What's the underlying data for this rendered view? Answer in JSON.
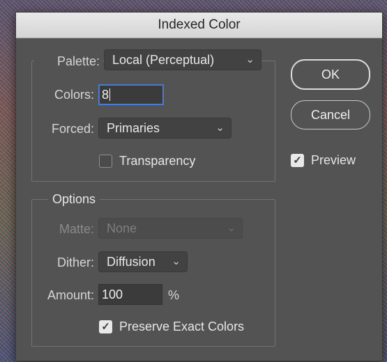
{
  "dialog": {
    "title": "Indexed Color"
  },
  "palette_group": {
    "palette_label": "Palette:",
    "palette_value": "Local (Perceptual)",
    "colors_label": "Colors:",
    "colors_value": "8",
    "forced_label": "Forced:",
    "forced_value": "Primaries",
    "transparency_label": "Transparency",
    "transparency_checked": false
  },
  "options_group": {
    "legend": "Options",
    "matte_label": "Matte:",
    "matte_value": "None",
    "dither_label": "Dither:",
    "dither_value": "Diffusion",
    "amount_label": "Amount:",
    "amount_value": "100",
    "amount_unit": "%",
    "preserve_label": "Preserve Exact Colors",
    "preserve_checked": true
  },
  "buttons": {
    "ok": "OK",
    "cancel": "Cancel"
  },
  "preview": {
    "label": "Preview",
    "checked": true
  },
  "icons": {
    "dropdown": "chevron-down-icon",
    "checkmark": "checkmark-icon"
  },
  "colors": {
    "focus_ring": "#4a7bd0",
    "dialog_bg": "#535353"
  }
}
